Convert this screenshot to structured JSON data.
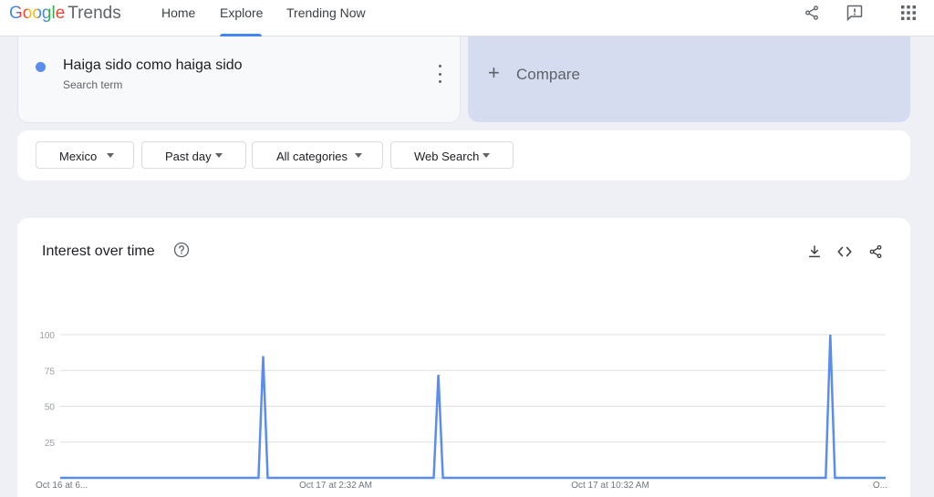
{
  "header": {
    "logo_google": "Google",
    "logo_trends": "Trends",
    "nav": [
      {
        "label": "Home",
        "active": false
      },
      {
        "label": "Explore",
        "active": true
      },
      {
        "label": "Trending Now",
        "active": false
      }
    ],
    "icons": [
      "share-icon",
      "feedback-icon",
      "apps-grid-icon"
    ]
  },
  "search": {
    "term": "Haiga sido como haiga sido",
    "term_sublabel": "Search term",
    "term_color": "#5b8def",
    "compare_label": "Compare"
  },
  "filters": [
    {
      "label": "Mexico"
    },
    {
      "label": "Past day"
    },
    {
      "label": "All categories"
    },
    {
      "label": "Web Search"
    }
  ],
  "chart_card": {
    "title": "Interest over time",
    "icons": [
      "help-icon",
      "download-icon",
      "embed-code-icon",
      "share-icon"
    ]
  },
  "chart_data": {
    "type": "line",
    "title": "Interest over time",
    "xlabel": "",
    "ylabel": "",
    "ylim": [
      0,
      100
    ],
    "yticks": [
      25,
      50,
      75,
      100
    ],
    "ytick_labels": [
      "25",
      "50",
      "75",
      "100"
    ],
    "grid": true,
    "x_tick_labels": [
      "Oct 16 at 6...",
      "Oct 17 at 2:32 AM",
      "Oct 17 at 10:32 AM",
      "O..."
    ],
    "series": [
      {
        "color": "#5b8def",
        "x": [
          0,
          1,
          2,
          3,
          4,
          5,
          6,
          7,
          8,
          9,
          10,
          11,
          12,
          13,
          14,
          15,
          16,
          17,
          18,
          19,
          20,
          21,
          22,
          23,
          24,
          25,
          26,
          27,
          28,
          29,
          30,
          31,
          32,
          33,
          34,
          35,
          36,
          37,
          38,
          39,
          40,
          41,
          42,
          43,
          44,
          45,
          46,
          47,
          48,
          49,
          50,
          51,
          52,
          53,
          54,
          55,
          56,
          57,
          58,
          59,
          60,
          61,
          62,
          63,
          64,
          65,
          66,
          67,
          68,
          69,
          70,
          71,
          72,
          73,
          74,
          75,
          76,
          77,
          78,
          79,
          80,
          81,
          82,
          83,
          84,
          85,
          86,
          87,
          88,
          89,
          90,
          91,
          92,
          93,
          94,
          95,
          96,
          97,
          98,
          99,
          100,
          101,
          102,
          103,
          104,
          105,
          106,
          107,
          108,
          109,
          110,
          111,
          112,
          113,
          114,
          115,
          116,
          117,
          118,
          119,
          120,
          121,
          122,
          123,
          124,
          125,
          126,
          127,
          128,
          129,
          130,
          131,
          132,
          133,
          134,
          135,
          136,
          137,
          138,
          139,
          140,
          141,
          142,
          143,
          144,
          145,
          146,
          147,
          148,
          149,
          150,
          151,
          152,
          153,
          154,
          155,
          156,
          157,
          158,
          159,
          160,
          161,
          162,
          163,
          164,
          165,
          166,
          167,
          168,
          169,
          170,
          171,
          172,
          173,
          174,
          175,
          176,
          177,
          178,
          179
        ],
        "values": [
          0,
          0,
          0,
          0,
          0,
          0,
          0,
          0,
          0,
          0,
          0,
          0,
          0,
          0,
          0,
          0,
          0,
          0,
          0,
          0,
          0,
          0,
          0,
          0,
          0,
          0,
          0,
          0,
          0,
          0,
          0,
          0,
          0,
          0,
          0,
          0,
          0,
          0,
          0,
          0,
          0,
          0,
          0,
          0,
          85,
          0,
          0,
          0,
          0,
          0,
          0,
          0,
          0,
          0,
          0,
          0,
          0,
          0,
          0,
          0,
          0,
          0,
          0,
          0,
          0,
          0,
          0,
          0,
          0,
          0,
          0,
          0,
          0,
          0,
          0,
          0,
          0,
          0,
          0,
          0,
          0,
          0,
          72,
          0,
          0,
          0,
          0,
          0,
          0,
          0,
          0,
          0,
          0,
          0,
          0,
          0,
          0,
          0,
          0,
          0,
          0,
          0,
          0,
          0,
          0,
          0,
          0,
          0,
          0,
          0,
          0,
          0,
          0,
          0,
          0,
          0,
          0,
          0,
          0,
          0,
          0,
          0,
          0,
          0,
          0,
          0,
          0,
          0,
          0,
          0,
          0,
          0,
          0,
          0,
          0,
          0,
          0,
          0,
          0,
          0,
          0,
          0,
          0,
          0,
          0,
          0,
          0,
          0,
          0,
          0,
          0,
          0,
          0,
          0,
          0,
          0,
          0,
          0,
          0,
          0,
          0,
          0,
          0,
          0,
          0,
          0,
          0,
          100,
          0,
          0,
          0,
          0,
          0,
          0,
          0,
          0,
          0,
          0,
          0,
          0
        ]
      }
    ]
  }
}
